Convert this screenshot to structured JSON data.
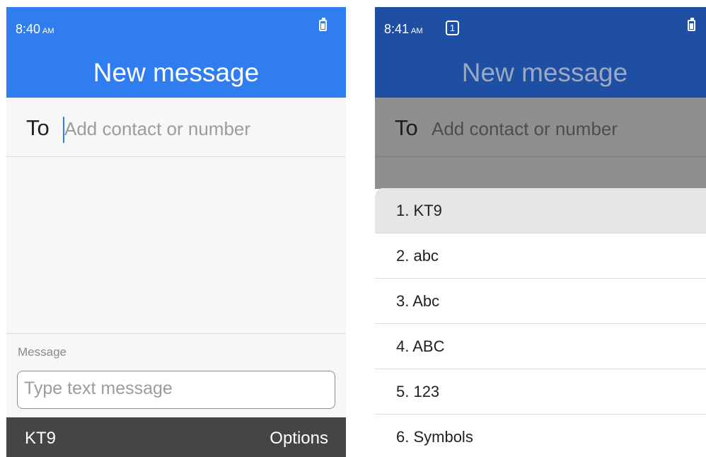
{
  "left": {
    "status": {
      "time": "8:40",
      "ampm": "AM"
    },
    "header": {
      "title": "New message"
    },
    "to": {
      "label": "To",
      "placeholder": "Add contact or number"
    },
    "message": {
      "label": "Message",
      "placeholder": "Type text message"
    },
    "softkeys": {
      "left": "KT9",
      "right": "Options"
    }
  },
  "right": {
    "status": {
      "time": "8:41",
      "ampm": "AM",
      "notification_count": "1"
    },
    "header": {
      "title": "New message"
    },
    "to": {
      "label": "To",
      "placeholder": "Add contact or number"
    },
    "menu": {
      "selected_index": 0,
      "items": [
        "1. KT9",
        "2. abc",
        "3. Abc",
        "4. ABC",
        "5. 123",
        "6. Symbols"
      ]
    }
  },
  "colors": {
    "header": "#2f7def",
    "header_dimmed": "#1f4fa2",
    "softkey_bar": "#454545"
  },
  "icons": [
    "battery-icon",
    "notification-badge"
  ]
}
